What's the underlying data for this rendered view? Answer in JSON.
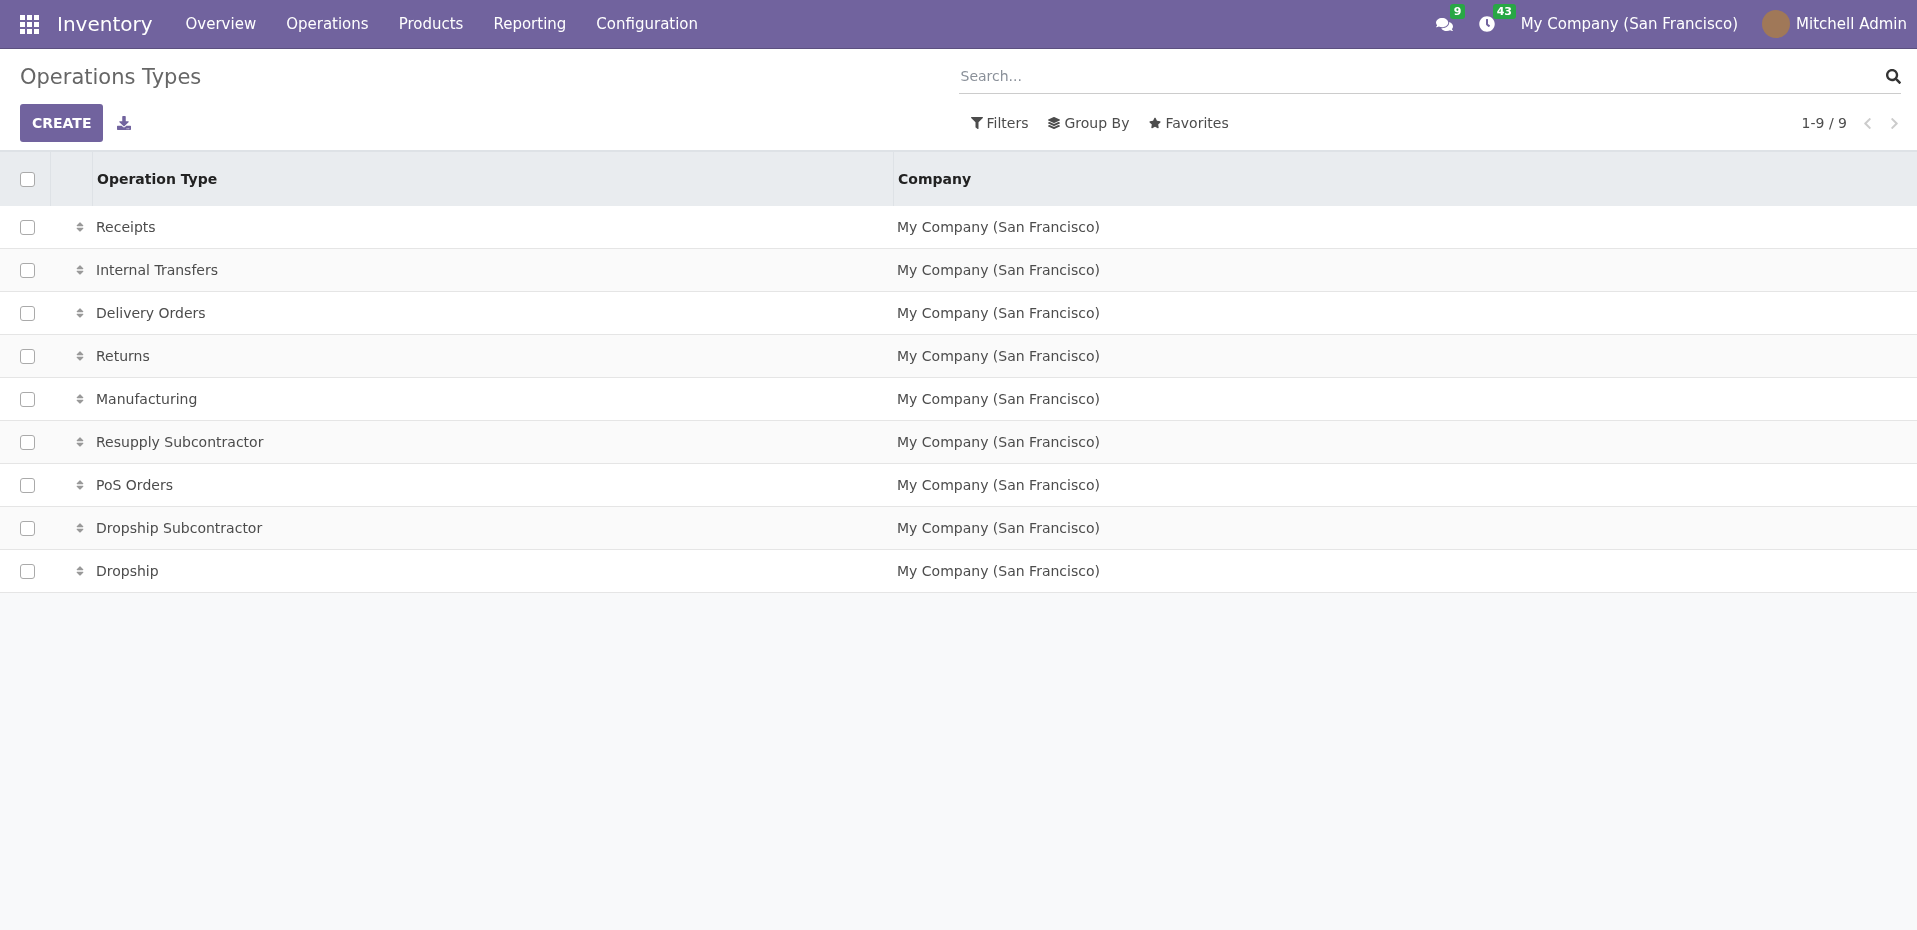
{
  "navbar": {
    "app_name": "Inventory",
    "menu": [
      "Overview",
      "Operations",
      "Products",
      "Reporting",
      "Configuration"
    ],
    "messages_count": "9",
    "activities_count": "43",
    "company": "My Company (San Francisco)",
    "user": "Mitchell Admin"
  },
  "control_panel": {
    "title": "Operations Types",
    "create_label": "CREATE",
    "search": {
      "placeholder": "Search..."
    },
    "filters": [
      "Filters",
      "Group By",
      "Favorites"
    ],
    "pager": "1-9 / 9"
  },
  "table": {
    "all_checked": false,
    "columns": [
      "Operation Type",
      "Company"
    ],
    "rows": [
      {
        "name": "Receipts",
        "company": "My Company (San Francisco)",
        "checked": false
      },
      {
        "name": "Internal Transfers",
        "company": "My Company (San Francisco)",
        "checked": false
      },
      {
        "name": "Delivery Orders",
        "company": "My Company (San Francisco)",
        "checked": false
      },
      {
        "name": "Returns",
        "company": "My Company (San Francisco)",
        "checked": false
      },
      {
        "name": "Manufacturing",
        "company": "My Company (San Francisco)",
        "checked": false
      },
      {
        "name": "Resupply Subcontractor",
        "company": "My Company (San Francisco)",
        "checked": false
      },
      {
        "name": "PoS Orders",
        "company": "My Company (San Francisco)",
        "checked": false
      },
      {
        "name": "Dropship Subcontractor",
        "company": "My Company (San Francisco)",
        "checked": false
      },
      {
        "name": "Dropship",
        "company": "My Company (San Francisco)",
        "checked": false
      }
    ]
  }
}
